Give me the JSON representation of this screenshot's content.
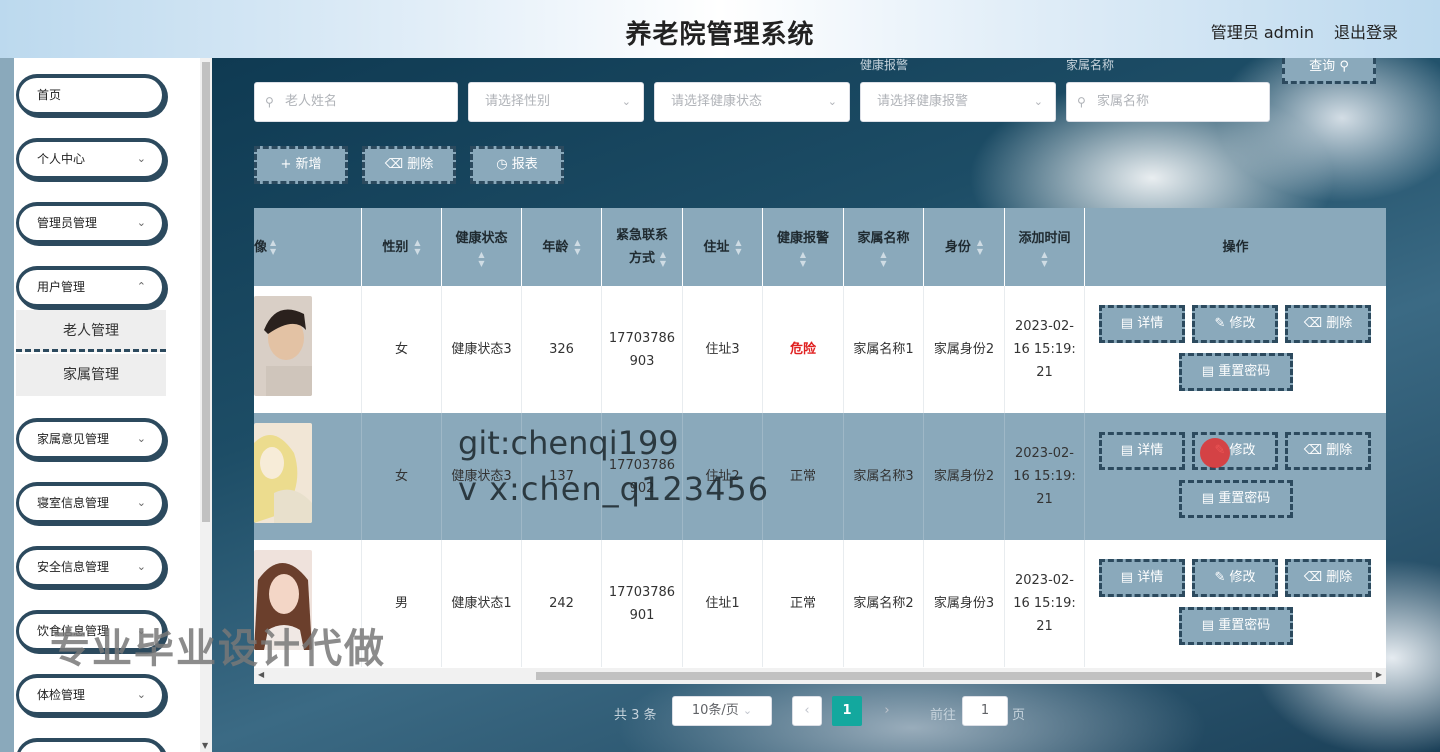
{
  "header": {
    "title": "养老院管理系统",
    "admin": "管理员 admin",
    "logout": "退出登录"
  },
  "sidebar": {
    "items": [
      {
        "label": "首页",
        "chevron": false
      },
      {
        "label": "个人中心",
        "chevron": true
      },
      {
        "label": "管理员管理",
        "chevron": true
      },
      {
        "label": "用户管理",
        "chevron": true
      },
      {
        "label": "家属意见管理",
        "chevron": true
      },
      {
        "label": "寝室信息管理",
        "chevron": true
      },
      {
        "label": "安全信息管理",
        "chevron": true
      },
      {
        "label": "饮食信息管理",
        "chevron": true
      },
      {
        "label": "体检管理",
        "chevron": true
      }
    ],
    "subitems": [
      "老人管理",
      "家属管理"
    ]
  },
  "ghost_labels": {
    "health_alarm": "健康报警",
    "family_name": "家属名称"
  },
  "search": {
    "button": "查询",
    "elder_name_placeholder": "老人姓名",
    "gender_placeholder": "请选择性别",
    "health_status_placeholder": "请选择健康状态",
    "health_alarm_placeholder": "请选择健康报警",
    "family_name_placeholder": "家属名称"
  },
  "actions": {
    "add": "新增",
    "delete": "删除",
    "report": "报表"
  },
  "table": {
    "headers": {
      "photo": "像",
      "gender": "性别",
      "health": "健康状态",
      "age": "年龄",
      "contact": "紧急联系方式",
      "address": "住址",
      "alarm": "健康报警",
      "family": "家属名称",
      "identity": "身份",
      "time": "添加时间",
      "ops": "操作"
    },
    "rows": [
      {
        "gender": "女",
        "health": "健康状态3",
        "age": "326",
        "contact": "17703786903",
        "address": "住址3",
        "alarm": "危险",
        "family": "家属名称1",
        "identity": "家属身份2",
        "time": "2023-02-16 15:19:21"
      },
      {
        "gender": "女",
        "health": "健康状态3",
        "age": "137",
        "contact": "17703786902",
        "address": "住址2",
        "alarm": "正常",
        "family": "家属名称3",
        "identity": "家属身份2",
        "time": "2023-02-16 15:19:21"
      },
      {
        "gender": "男",
        "health": "健康状态1",
        "age": "242",
        "contact": "17703786901",
        "address": "住址1",
        "alarm": "正常",
        "family": "家属名称2",
        "identity": "家属身份3",
        "time": "2023-02-16 15:19:21"
      }
    ],
    "op_labels": {
      "detail": "详情",
      "edit": "修改",
      "delete": "删除",
      "reset": "重置密码"
    }
  },
  "pagination": {
    "total": "共 3 条",
    "page_size": "10条/页",
    "current": "1",
    "goto_prefix": "前往",
    "goto_value": "1",
    "goto_suffix": "页"
  },
  "watermarks": {
    "git": "git:chenqi199",
    "vx": "v x:chen_q123456",
    "banner": "专业毕业设计代做"
  },
  "colors": {
    "accent": "#8aa9bb",
    "border": "#2c4a5e",
    "active_page": "#13a89e",
    "danger": "#e02020"
  }
}
